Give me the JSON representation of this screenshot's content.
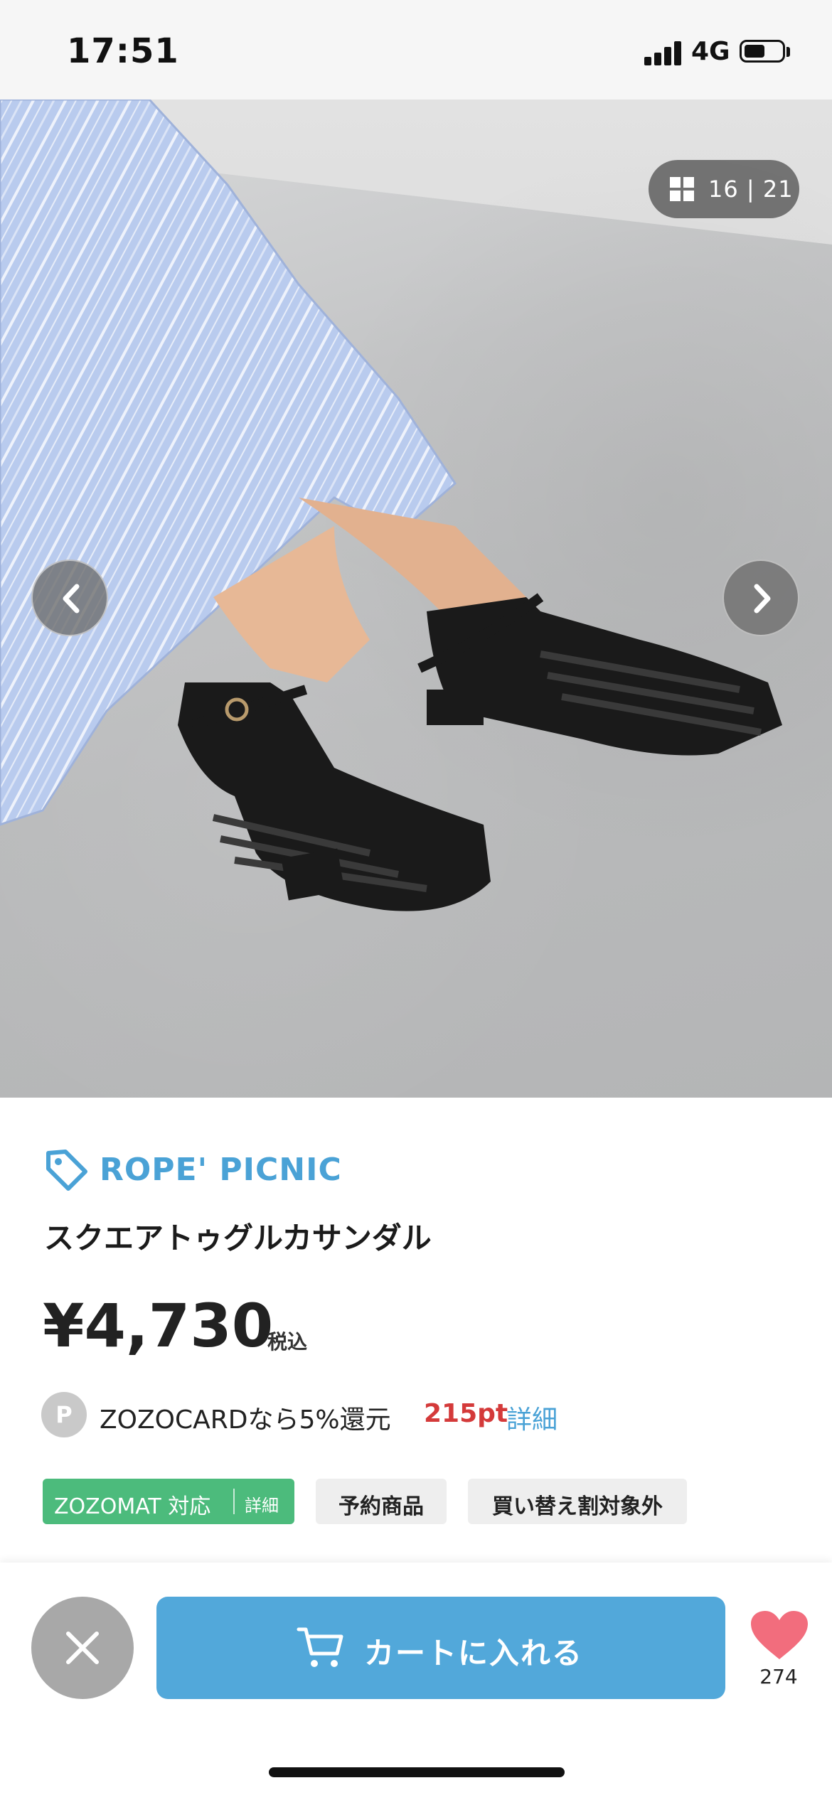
{
  "status_bar": {
    "time": "17:51",
    "network": "4G"
  },
  "gallery": {
    "counter": "16 | 21"
  },
  "product": {
    "brand": "ROPE' PICNIC",
    "name": "スクエアトゥグルカサンダル",
    "price": "¥4,730",
    "tax_label": "税込"
  },
  "points": {
    "icon_letter": "P",
    "text": "ZOZOCARDなら5%還元",
    "value": "215pt",
    "detail": "詳細"
  },
  "badges": {
    "zozomat": "ZOZOMAT 対応",
    "zozomat_detail": "詳細",
    "preorder": "予約商品",
    "trade_in": "買い替え割対象外"
  },
  "actions": {
    "cart_label": "カートに入れる",
    "favorite_count": "274"
  },
  "colors": {
    "accent": "#52a8da",
    "brand_text": "#4aa2d6",
    "points": "#d43a3a",
    "zozomat": "#4cbb7c"
  }
}
